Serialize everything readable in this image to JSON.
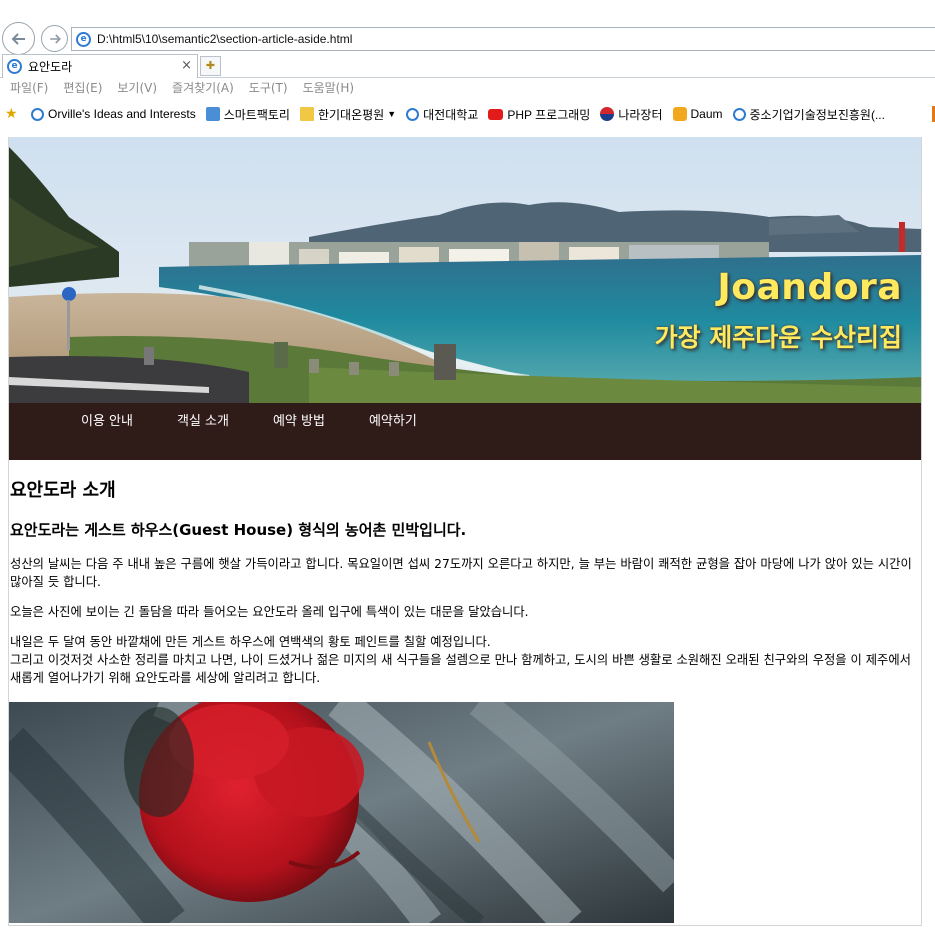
{
  "browser": {
    "address": "D:\\html5\\10\\semantic2\\section-article-aside.html",
    "tab_title": "요안도라",
    "tab_close": "×",
    "menu": [
      "파일(F)",
      "편집(E)",
      "보기(V)",
      "즐겨찾기(A)",
      "도구(T)",
      "도움말(H)"
    ],
    "favorites": [
      {
        "label": "Orville's Ideas and Interests",
        "icon": "ie-page-icon"
      },
      {
        "label": "스마트팩토리",
        "icon": "cloud-icon"
      },
      {
        "label": "한기대온평원",
        "icon": "folder-icon"
      },
      {
        "label": "대전대학교",
        "icon": "ie-page-icon"
      },
      {
        "label": "PHP 프로그래밍",
        "icon": "youtube-icon"
      },
      {
        "label": "나라장터",
        "icon": "korea-flag-icon"
      },
      {
        "label": "Daum",
        "icon": "daum-icon"
      },
      {
        "label": "중소기업기술정보진흥원(...",
        "icon": "ie-page-icon"
      }
    ]
  },
  "page": {
    "hero_title": "Joandora",
    "hero_subtitle": "가장 제주다운 수산리집",
    "nav": [
      "이용 안내",
      "객실 소개",
      "예약 방법",
      "예약하기"
    ],
    "heading": "요안도라 소개",
    "subheading": "요안도라는 게스트 하우스(Guest House) 형식의 농어촌 민박입니다.",
    "paragraph1": "성산의 날씨는 다음 주 내내 높은 구름에 햇살 가득이라고 합니다. 목요일이면 섭씨 27도까지 오른다고 하지만, 늘 부는 바람이 쾌적한 균형을 잡아 마당에 나가 앉아 있는 시간이 많아질 듯 합니다.",
    "paragraph2": "오늘은 사진에 보이는 긴 돌담을 따라 들어오는 요안도라 올레 입구에 특색이 있는 대문을 달았습니다.",
    "paragraph3_line1": "내일은 두 달여 동안 바깥채에 만든 게스트 하우스에 연백색의 황토 페인트를 칠할 예정입니다.",
    "paragraph3_line2": "그리고 이것저것 사소한 정리를 마치고 나면, 나이 드셨거나 젊은 미지의 새 식구들을 설렘으로 만나 함께하고, 도시의 바쁜 생활로 소원해진 오래된 친구와의 우정을 이 제주에서 새롭게 열어나가기 위해 요안도라를 세상에 알리려고 합니다."
  },
  "colors": {
    "nav_background": "#2f1b18",
    "hero_text": "#ffe95e",
    "ie_blue": "#2f7bd3"
  }
}
